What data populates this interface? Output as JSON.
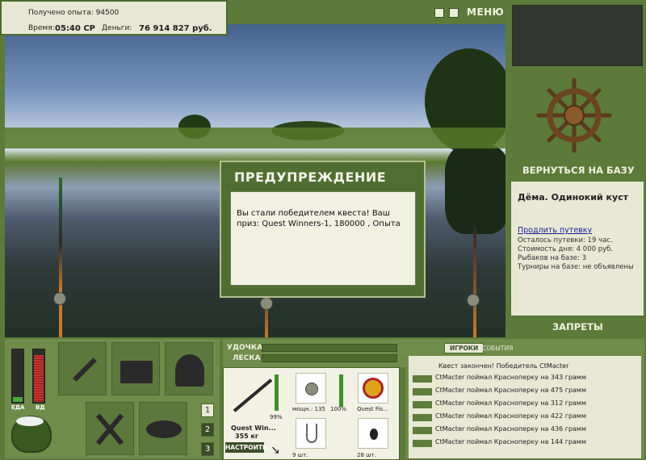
{
  "info": {
    "exp_label": "Получено опыта: 94500",
    "time_label": "Время:",
    "time_value": "05:40 СР",
    "money_label": "Деньги:",
    "money_value": "76 914 827 руб."
  },
  "top_right": {
    "menu_label": "МЕНЮ",
    "back_to_base": "ВЕРНУТЬСЯ НА БАЗУ",
    "bans": "ЗАПРЕТЫ"
  },
  "location": {
    "title": "Дёма. Одинокий куст",
    "extend_link": "Продлить путевку",
    "rows": [
      "Осталось путевки: 19 час.",
      "Стоимость дня: 4 000 руб.",
      "Рыбаков на базе: 3",
      "Турниры на базе: не объявлены"
    ]
  },
  "modal": {
    "title": "ПРЕДУПРЕЖДЕНИЕ",
    "text": "Вы стали победителем квеста! Ваш приз: Quest Winners-1, 180000 , Опыта"
  },
  "stats": {
    "food_label": "ЕДА",
    "hunger_label": "ВД",
    "food_level": 0.1,
    "hunger_level": 0.9
  },
  "pages": [
    "1",
    "2",
    "3"
  ],
  "tackle": {
    "rod_label": "УДОЧКА",
    "line_label": "ЛЕСКА",
    "rod_name": "Quest Win...",
    "rod_weight": "355 кг",
    "rod_pct": "99%",
    "reel_power": "мощн.: 135",
    "reel_pct": "100%",
    "line_name": "Quest Fis...",
    "hook_count": "9 шт.",
    "bait_count": "28 шт.",
    "setup_label": "НАСТРОИТЬ"
  },
  "log": {
    "tab_players": "ИГРОКИ",
    "tab_events": "СОБЫТИЯ",
    "first_line": "Квест закончен! Победитель CtMacter",
    "catches": [
      "CtMacter поймал Красноперку на 343 грамм",
      "CtMacter поймал Красноперку на 475 грамм",
      "CtMacter поймал Красноперку на 312 грамм",
      "CtMacter поймал Красноперку на 422 грамм",
      "CtMacter поймал Красноперку на 436 грамм",
      "CtMacter поймал Красноперку на 144 грамм"
    ]
  }
}
